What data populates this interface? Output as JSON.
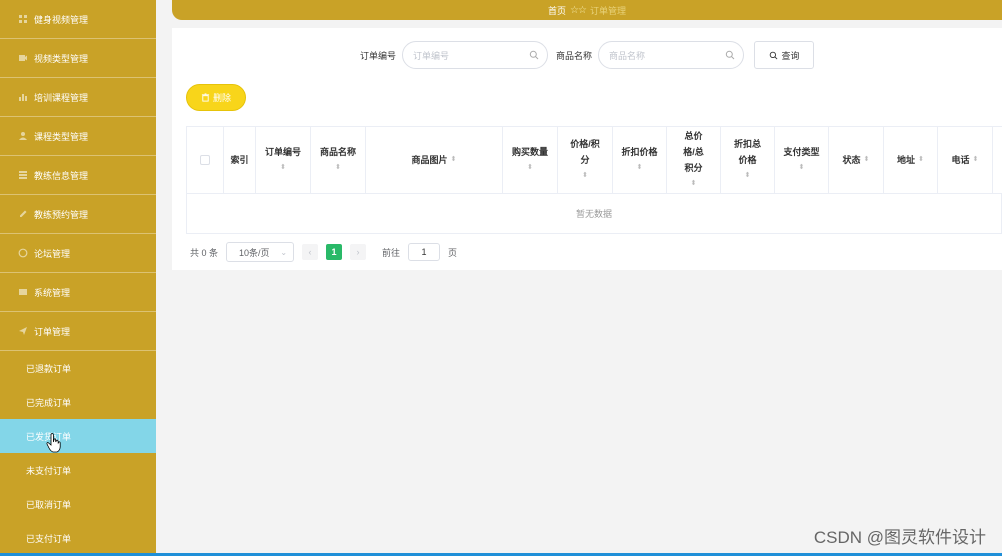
{
  "sidebar": {
    "items": [
      {
        "label": "健身视频管理",
        "icon": "grid-icon"
      },
      {
        "label": "视频类型管理",
        "icon": "video-icon"
      },
      {
        "label": "培训课程管理",
        "icon": "bar-chart-icon"
      },
      {
        "label": "课程类型管理",
        "icon": "user-icon"
      },
      {
        "label": "教练信息管理",
        "icon": "list-icon"
      },
      {
        "label": "教练预约管理",
        "icon": "edit-icon"
      },
      {
        "label": "论坛管理",
        "icon": "chat-icon"
      },
      {
        "label": "系统管理",
        "icon": "settings-icon"
      },
      {
        "label": "订单管理",
        "icon": "send-icon"
      }
    ],
    "subitems": [
      {
        "label": "已退款订单"
      },
      {
        "label": "已完成订单"
      },
      {
        "label": "已发货订单"
      },
      {
        "label": "未支付订单"
      },
      {
        "label": "已取消订单"
      },
      {
        "label": "已支付订单"
      }
    ],
    "active_subitem": "已发货订单"
  },
  "header": {
    "home": "首页",
    "current": "订单管理"
  },
  "search": {
    "order_no_label": "订单编号",
    "order_no_placeholder": "订单编号",
    "product_label": "商品名称",
    "product_placeholder": "商品名称",
    "query_button": "查询"
  },
  "toolbar": {
    "delete_button": "删除"
  },
  "table": {
    "columns": [
      "索引",
      "订单编号",
      "商品名称",
      "商品图片",
      "购买数量",
      "价格/积分",
      "折扣价格",
      "总价格/总积分",
      "折扣总价格",
      "支付类型",
      "状态",
      "地址",
      "电话"
    ],
    "empty_text": "暂无数据"
  },
  "pagination": {
    "total_text": "共 0 条",
    "page_size": "10条/页",
    "current_page": "1",
    "goto_label": "前往",
    "goto_value": "1",
    "page_suffix": "页"
  },
  "watermark": "CSDN @图灵软件设计",
  "colors": {
    "sidebar": "#c9a227",
    "active": "#83d6e8",
    "delete": "#f8d51a",
    "page_active": "#29b968"
  }
}
